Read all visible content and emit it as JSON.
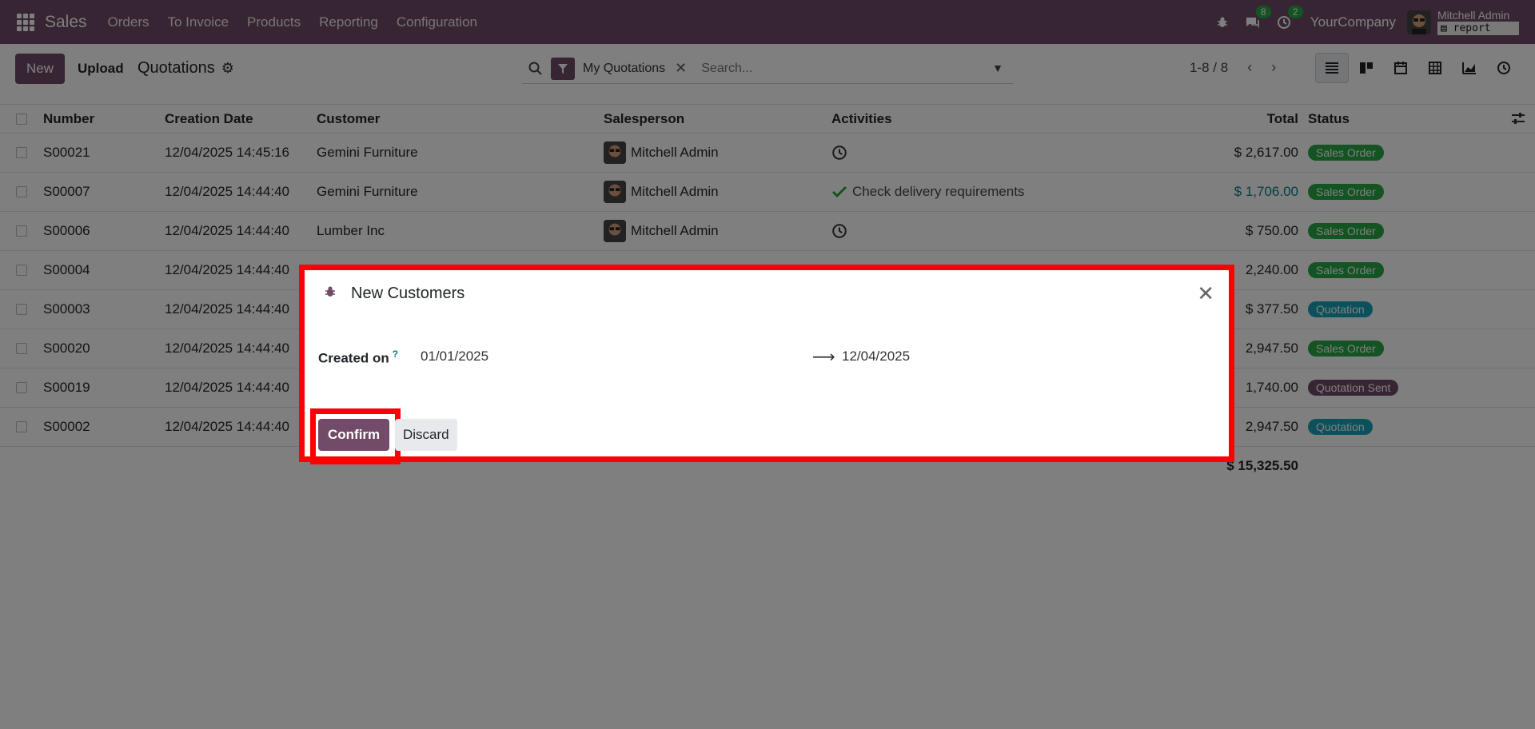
{
  "navbar": {
    "brand": "Sales",
    "menu": [
      "Orders",
      "To Invoice",
      "Products",
      "Reporting",
      "Configuration"
    ],
    "messages_count": "8",
    "activities_count": "2",
    "company": "YourCompany",
    "user": "Mitchell Admin",
    "db": "report"
  },
  "control": {
    "new_label": "New",
    "upload_label": "Upload",
    "breadcrumb": "Quotations",
    "facet_label": "My Quotations",
    "search_placeholder": "Search...",
    "pager": "1-8 / 8"
  },
  "list": {
    "headers": {
      "number": "Number",
      "date": "Creation Date",
      "customer": "Customer",
      "salesperson": "Salesperson",
      "activities": "Activities",
      "total": "Total",
      "status": "Status"
    },
    "rows": [
      {
        "number": "S00021",
        "date": "12/04/2025 14:45:16",
        "customer": "Gemini Furniture",
        "salesperson": "Mitchell Admin",
        "activity": "",
        "total": "$ 2,617.00",
        "status": "Sales Order"
      },
      {
        "number": "S00007",
        "date": "12/04/2025 14:44:40",
        "customer": "Gemini Furniture",
        "salesperson": "Mitchell Admin",
        "activity": "Check delivery requirements",
        "total": "$ 1,706.00",
        "status": "Sales Order"
      },
      {
        "number": "S00006",
        "date": "12/04/2025 14:44:40",
        "customer": "Lumber Inc",
        "salesperson": "Mitchell Admin",
        "activity": "",
        "total": "$ 750.00",
        "status": "Sales Order"
      },
      {
        "number": "S00004",
        "date": "12/04/2025 14:44:40",
        "customer": "",
        "salesperson": "",
        "activity": "",
        "total": "2,240.00",
        "status": "Sales Order"
      },
      {
        "number": "S00003",
        "date": "12/04/2025 14:44:40",
        "customer": "",
        "salesperson": "",
        "activity": "",
        "total": "$ 377.50",
        "status": "Quotation"
      },
      {
        "number": "S00020",
        "date": "12/04/2025 14:44:40",
        "customer": "",
        "salesperson": "",
        "activity": "",
        "total": "2,947.50",
        "status": "Sales Order"
      },
      {
        "number": "S00019",
        "date": "12/04/2025 14:44:40",
        "customer": "",
        "salesperson": "",
        "activity": "",
        "total": "1,740.00",
        "status": "Quotation Sent"
      },
      {
        "number": "S00002",
        "date": "12/04/2025 14:44:40",
        "customer": "",
        "salesperson": "",
        "activity": "",
        "total": "2,947.50",
        "status": "Quotation"
      }
    ],
    "sum_total": "$ 15,325.50"
  },
  "status_colors": {
    "Sales Order": "#28a745",
    "Quotation": "#17a2b8",
    "Quotation Sent": "#714b67"
  },
  "dialog": {
    "title": "New Customers",
    "field_label": "Created on",
    "help_mark": "?",
    "date_from": "01/01/2025",
    "date_to": "12/04/2025",
    "confirm_label": "Confirm",
    "discard_label": "Discard"
  }
}
